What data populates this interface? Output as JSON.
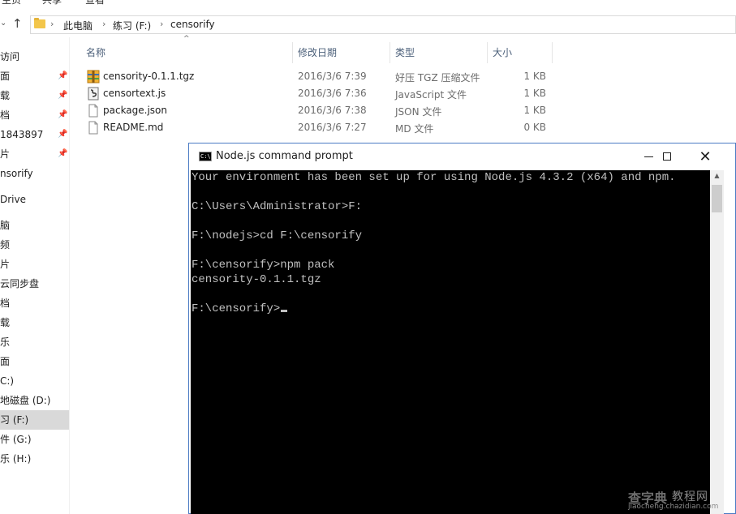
{
  "ribbon": {
    "tabs": [
      "主页",
      "共享",
      "查看"
    ]
  },
  "address": {
    "crumbs": [
      "此电脑",
      "练习 (F:)",
      "censorify"
    ]
  },
  "sidebar": {
    "items": [
      {
        "label": "访问",
        "pinned": false
      },
      {
        "label": "面",
        "pinned": true
      },
      {
        "label": "载",
        "pinned": true
      },
      {
        "label": "档",
        "pinned": true
      },
      {
        "label": "1843897",
        "pinned": true
      },
      {
        "label": "片",
        "pinned": true
      },
      {
        "label": "nsorify",
        "pinned": false
      },
      {
        "label": "Drive",
        "pinned": false
      },
      {
        "label": "脑",
        "pinned": false
      },
      {
        "label": "频",
        "pinned": false
      },
      {
        "label": "片",
        "pinned": false
      },
      {
        "label": "云同步盘",
        "pinned": false
      },
      {
        "label": "档",
        "pinned": false
      },
      {
        "label": "载",
        "pinned": false
      },
      {
        "label": "乐",
        "pinned": false
      },
      {
        "label": "面",
        "pinned": false
      },
      {
        "label": "C:)",
        "pinned": false
      },
      {
        "label": "地磁盘 (D:)",
        "pinned": false
      },
      {
        "label": "习 (F:)",
        "pinned": false
      },
      {
        "label": "件 (G:)",
        "pinned": false
      },
      {
        "label": "乐 (H:)",
        "pinned": false
      }
    ],
    "selected_index": 18
  },
  "columns": {
    "name": "名称",
    "date": "修改日期",
    "type": "类型",
    "size": "大小"
  },
  "files": [
    {
      "name": "censority-0.1.1.tgz",
      "date": "2016/3/6 7:39",
      "type": "好压 TGZ 压缩文件",
      "size": "1 KB",
      "icon": "archive-icon"
    },
    {
      "name": "censortext.js",
      "date": "2016/3/6 7:36",
      "type": "JavaScript 文件",
      "size": "1 KB",
      "icon": "script-icon"
    },
    {
      "name": "package.json",
      "date": "2016/3/6 7:38",
      "type": "JSON 文件",
      "size": "1 KB",
      "icon": "file-icon"
    },
    {
      "name": "README.md",
      "date": "2016/3/6 7:27",
      "type": "MD 文件",
      "size": "0 KB",
      "icon": "file-icon"
    }
  ],
  "cmd": {
    "title": "Node.js command prompt",
    "icon_text": "C:\\",
    "lines": [
      "Your environment has been set up for using Node.js 4.3.2 (x64) and npm.",
      "",
      "C:\\Users\\Administrator>F:",
      "",
      "F:\\nodejs>cd F:\\censorify",
      "",
      "F:\\censorify>npm pack",
      "censority-0.1.1.tgz",
      "",
      "F:\\censorify>"
    ]
  },
  "watermark": {
    "brand": "查字典",
    "sub": "教程网",
    "url": "jiaocheng.chazidian.com"
  },
  "colors": {
    "console_bg": "#000000",
    "console_text": "#c0c0c0",
    "selected": "#d9d9d9",
    "window_border": "#4a7bc4"
  }
}
